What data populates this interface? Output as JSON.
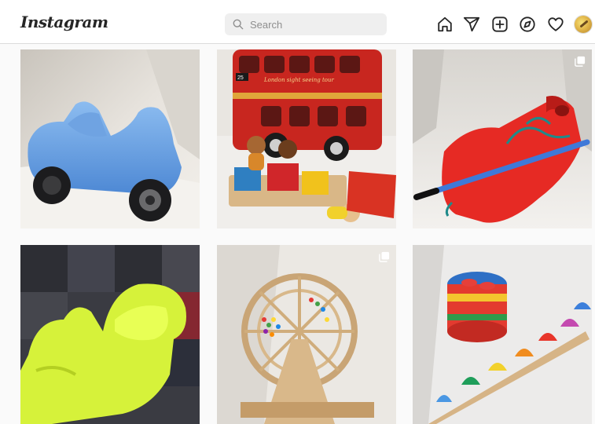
{
  "header": {
    "logo_text": "Instagram",
    "search": {
      "placeholder": "Search",
      "icon": "search-icon"
    },
    "nav_icons": [
      "home-icon",
      "direct-icon",
      "new-post-icon",
      "explore-icon",
      "activity-icon",
      "profile-avatar"
    ]
  },
  "bus_text": {
    "route": "25",
    "banner": "London sight seeing tour"
  },
  "posts": [
    {
      "subject": "blue toy car",
      "multi": false
    },
    {
      "subject": "red double-decker toy bus with wooden peg people",
      "multi": false
    },
    {
      "subject": "red plastic scooter board with blue rope",
      "multi": true
    },
    {
      "subject": "yellow-green rocking seat",
      "multi": false
    },
    {
      "subject": "wooden ferris wheel with beads",
      "multi": true
    },
    {
      "subject": "drum and colorful bells xylophone",
      "multi": false
    }
  ],
  "colors": {
    "accent_text": "#262626",
    "muted_text": "#8e8e8e",
    "border": "#dbdbdb",
    "background": "#fafafa"
  }
}
